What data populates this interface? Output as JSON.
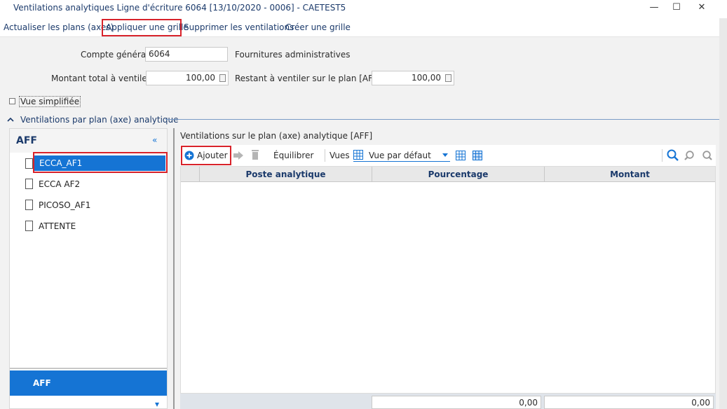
{
  "window": {
    "title": "Ventilations analytiques Ligne d'écriture 6064 [13/10/2020 - 0006] - CAETEST5",
    "minimize": "—",
    "maximize": "☐",
    "close": "✕"
  },
  "menu": {
    "refresh_plans": "Actualiser les plans (axes)",
    "apply_grid": "Appliquer une grille",
    "delete_ventilations": "Supprimer les ventilations",
    "create_grid": "Créer une grille"
  },
  "form": {
    "account_label": "Compte général",
    "account_value": "6064",
    "account_desc": "Fournitures administratives",
    "total_label": "Montant total à ventiler",
    "total_value": "100,00",
    "remaining_label": "Restant à ventiler sur le plan [AFF]",
    "remaining_value": "100,00",
    "simplified_view": "Vue simplifiée"
  },
  "section": {
    "title": "Ventilations par plan (axe) analytique"
  },
  "left_panel": {
    "header": "AFF",
    "collapse": "«",
    "items": [
      {
        "label": "ECCA_AF1",
        "selected": true
      },
      {
        "label": "ECCA AF2",
        "selected": false
      },
      {
        "label": "PICOSO_AF1",
        "selected": false
      },
      {
        "label": "ATTENTE",
        "selected": false
      }
    ],
    "bottom_tab": "AFF",
    "bottom_arrow": "▾"
  },
  "right_panel": {
    "title": "Ventilations sur le plan (axe) analytique [AFF]",
    "toolbar": {
      "add": "Ajouter",
      "balance": "Équilibrer",
      "views_label": "Vues",
      "view_value": "Vue par défaut"
    },
    "columns": [
      "Poste analytique",
      "Pourcentage",
      "Montant"
    ],
    "footer": {
      "percent_total": "0,00",
      "amount_total": "0,00"
    }
  },
  "colors": {
    "accent": "#1574d4",
    "highlight": "#d8222a",
    "header_text": "#1b3a6b"
  }
}
